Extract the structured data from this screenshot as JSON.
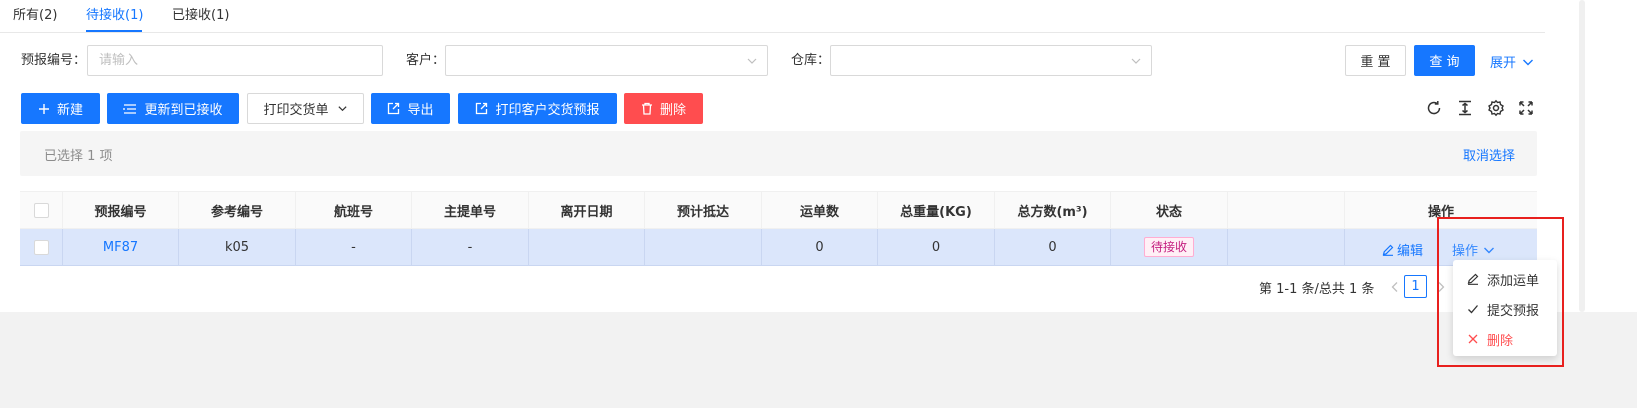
{
  "tabs": [
    {
      "label": "所有(2)"
    },
    {
      "label": "待接收(1)"
    },
    {
      "label": "已接收(1)"
    }
  ],
  "filters": {
    "forecast_no_label": "预报编号",
    "forecast_no_placeholder": "请输入",
    "customer_label": "客户",
    "warehouse_label": "仓库",
    "reset_label": "重 置",
    "search_label": "查 询",
    "expand_label": "展开"
  },
  "toolbar": {
    "new_label": "新建",
    "update_received_label": "更新到已接收",
    "print_delivery_label": "打印交货单",
    "export_label": "导出",
    "print_customer_label": "打印客户交货预报",
    "delete_label": "删除"
  },
  "selection": {
    "text": "已选择  1  项",
    "cancel_label": "取消选择"
  },
  "table": {
    "headers": [
      "预报编号",
      "参考编号",
      "航班号",
      "主提单号",
      "离开日期",
      "预计抵达",
      "运单数",
      "总重量(KG)",
      "总方数(m³)",
      "状态",
      "",
      "操作"
    ],
    "rows": [
      {
        "forecast_no": "MF87",
        "ref_no": "k05",
        "flight_no": "-",
        "mawb": "-",
        "depart_date": "",
        "eta": "",
        "waybill_count": "0",
        "total_weight": "0",
        "total_volume": "0",
        "status": "待接收",
        "edit_label": "编辑",
        "more_label": "操作"
      }
    ]
  },
  "pagination": {
    "total_text": "第 1-1 条/总共 1 条",
    "current_page": "1"
  },
  "dropdown_menu": {
    "items": [
      {
        "label": "添加运单",
        "icon": "edit-icon"
      },
      {
        "label": "提交预报",
        "icon": "check-icon"
      },
      {
        "label": "删除",
        "icon": "close-icon"
      }
    ]
  },
  "colors": {
    "primary": "#1677ff",
    "danger": "#ff4d4f",
    "status_tag": "#c41d7f",
    "highlight": "#e8201e"
  }
}
